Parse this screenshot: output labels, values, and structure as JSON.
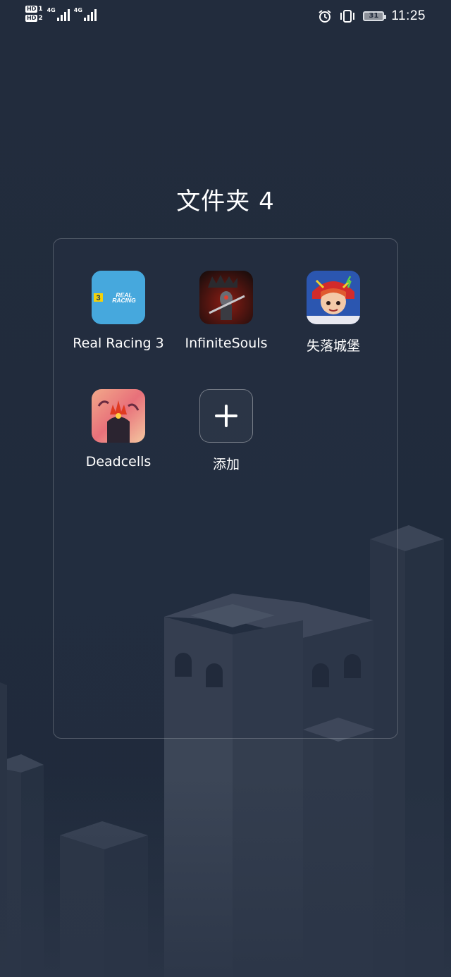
{
  "status_bar": {
    "sim1_label": "HD",
    "sim1_sub": "1",
    "sim2_label": "HD",
    "sim2_sub": "2",
    "net1": "4G",
    "net2": "4G",
    "battery_level": "31",
    "time": "11:25"
  },
  "folder": {
    "title": "文件夹 4",
    "apps": [
      {
        "name": "Real Racing 3",
        "icon": "real-racing-icon"
      },
      {
        "name": "InfiniteSouls",
        "icon": "infinite-souls-icon"
      },
      {
        "name": "失落城堡",
        "icon": "lost-castle-icon"
      },
      {
        "name": "Deadcells",
        "icon": "deadcells-icon"
      },
      {
        "name": "添加",
        "icon": "plus-icon"
      }
    ]
  }
}
